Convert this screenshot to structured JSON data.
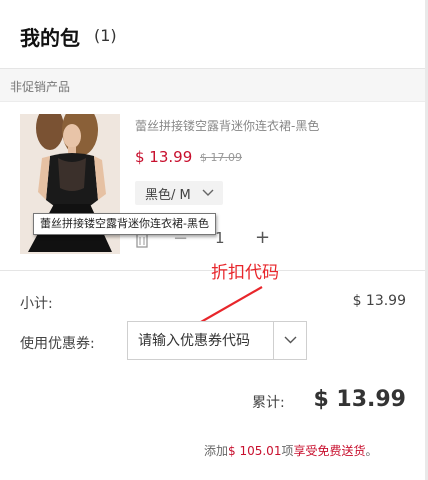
{
  "header": {
    "title": "我的包",
    "count": "(1)"
  },
  "section": {
    "label": "非促销产品"
  },
  "product": {
    "name": "蕾丝拼接镂空露背迷你连衣裙-黑色",
    "price": "$ 13.99",
    "old_price": "$ 17.09",
    "variant": "黑色/ M",
    "quantity": "1",
    "tooltip": "蕾丝拼接镂空露背迷你连衣裙-黑色"
  },
  "annotation": {
    "label": "折扣代码",
    "color": "#e8262b"
  },
  "summary": {
    "subtotal_label": "小计:",
    "subtotal_value": "$ 13.99",
    "coupon_label": "使用优惠券:",
    "coupon_placeholder": "请输入优惠券代码",
    "total_label": "累计:",
    "total_value": "$ 13.99"
  },
  "shipping": {
    "prefix": "添加",
    "amount": "$ 105.01",
    "middle": "项",
    "suffix": "享受免费送货",
    "end": "。"
  },
  "colors": {
    "price_red": "#c8102e",
    "annotation_red": "#e8262b"
  },
  "icons": [
    "chevron-down-icon",
    "trash-icon",
    "minus-icon",
    "plus-icon",
    "dropdown-chevron-icon",
    "arrow-icon"
  ]
}
